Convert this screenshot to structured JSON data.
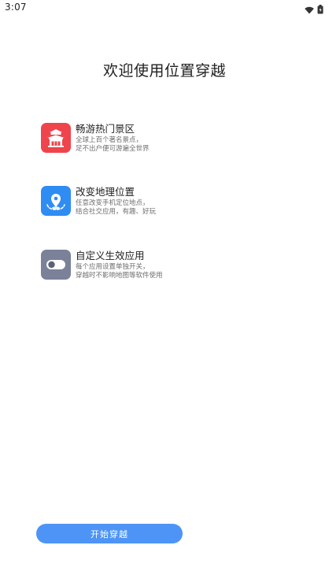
{
  "status_bar": {
    "time": "3:07",
    "icons": [
      "wifi-icon",
      "battery-icon"
    ]
  },
  "welcome": {
    "title": "欢迎使用位置穿越"
  },
  "features": [
    {
      "icon": "pagoda-icon",
      "color": "#f0444d",
      "title": "畅游热门景区",
      "desc_line1": "全球上百个著名景点，",
      "desc_line2": "足不出户便可游遍全世界"
    },
    {
      "icon": "map-pin-icon",
      "color": "#2f8cf3",
      "title": "改变地理位置",
      "desc_line1": "任意改变手机定位地点，",
      "desc_line2": "结合社交应用，有趣、好玩"
    },
    {
      "icon": "toggle-icon",
      "color": "#7a8199",
      "title": "自定义生效应用",
      "desc_line1": "每个应用设置单独开关，",
      "desc_line2": "穿越时不影响地图等软件使用"
    }
  ],
  "start_button": {
    "label": "开始穿越",
    "color": "#4d94f6"
  }
}
